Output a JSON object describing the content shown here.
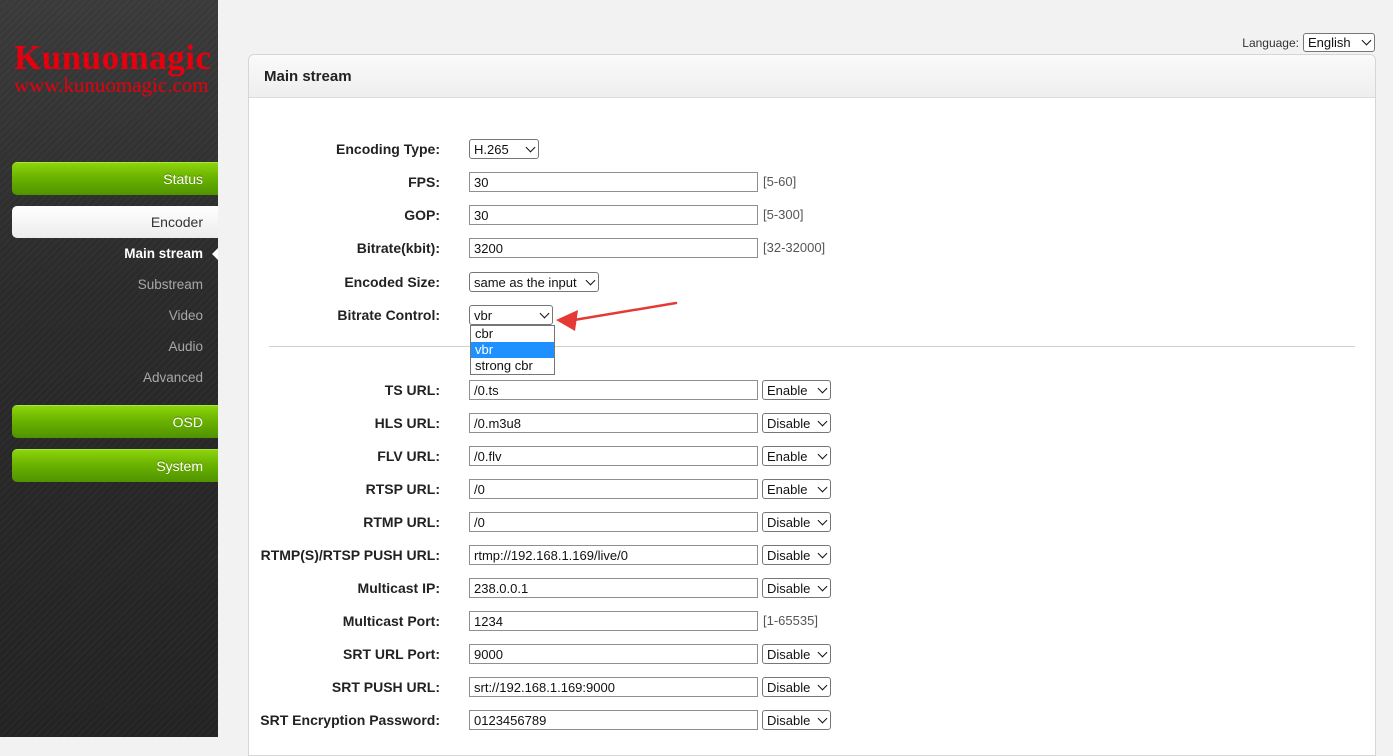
{
  "brand": {
    "name": "Kunuomagic",
    "url": "www.kunuomagic.com",
    "color": "#e6000e"
  },
  "language": {
    "label": "Language:",
    "value": "English"
  },
  "sidebar": {
    "status": "Status",
    "encoder": "Encoder",
    "encoder_items": [
      "Main stream",
      "Substream",
      "Video",
      "Audio",
      "Advanced"
    ],
    "osd": "OSD",
    "system": "System"
  },
  "panel": {
    "title": "Main stream"
  },
  "form": {
    "encoding_type": {
      "label": "Encoding Type:",
      "value": "H.265"
    },
    "fps": {
      "label": "FPS:",
      "value": "30",
      "hint": "[5-60]"
    },
    "gop": {
      "label": "GOP:",
      "value": "30",
      "hint": "[5-300]"
    },
    "bitrate": {
      "label": "Bitrate(kbit):",
      "value": "3200",
      "hint": "[32-32000]"
    },
    "encoded_size": {
      "label": "Encoded Size:",
      "value": "same as the input"
    },
    "bitrate_control": {
      "label": "Bitrate Control:",
      "value": "vbr",
      "options": [
        "cbr",
        "vbr",
        "strong cbr"
      ],
      "highlighted": "vbr"
    }
  },
  "urls": [
    {
      "label": "TS URL:",
      "value": "/0.ts",
      "state": "Enable"
    },
    {
      "label": "HLS URL:",
      "value": "/0.m3u8",
      "state": "Disable"
    },
    {
      "label": "FLV URL:",
      "value": "/0.flv",
      "state": "Enable"
    },
    {
      "label": "RTSP URL:",
      "value": "/0",
      "state": "Enable"
    },
    {
      "label": "RTMP URL:",
      "value": "/0",
      "state": "Disable"
    },
    {
      "label": "RTMP(S)/RTSP PUSH URL:",
      "value": "rtmp://192.168.1.169/live/0",
      "state": "Disable"
    },
    {
      "label": "Multicast IP:",
      "value": "238.0.0.1",
      "state": "Disable"
    },
    {
      "label": "Multicast Port:",
      "value": "1234",
      "hint": "[1-65535]"
    },
    {
      "label": "SRT URL Port:",
      "value": "9000",
      "state": "Disable"
    },
    {
      "label": "SRT PUSH URL:",
      "value": "srt://192.168.1.169:9000",
      "state": "Disable"
    },
    {
      "label": "SRT Encryption Password:",
      "value": "0123456789",
      "state": "Disable"
    }
  ],
  "colors": {
    "menu_green": "#6bb300",
    "highlight": "#1e90ff",
    "annotation_arrow": "#e53935"
  }
}
